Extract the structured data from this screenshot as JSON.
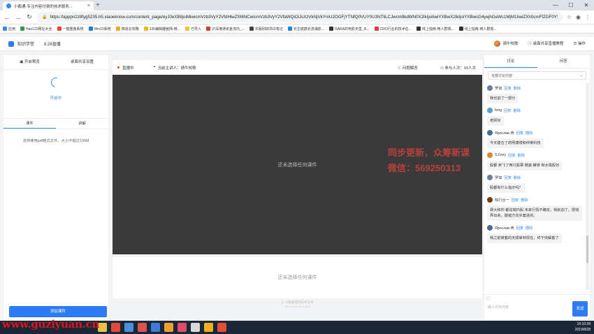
{
  "browser": {
    "tab_title": "小鹅通-专注内容付费的技术服务...",
    "new_tab": "+",
    "window_controls": [
      "—",
      "☐",
      "✕"
    ],
    "url": "https://apppn2z8fyg5235.h5.xiaoeknow.com/content_page/eyJ0eXBlIjoiMiwicmVzb3VyY2VfdHlwZSI6NCwicmVzb3VyY2VfaWQiOiJsXzVkNjVkYmU2OGFjYTNfQ0VUY0U3NTliLCJwcm9kdWN0X2lkIjoiIiwiYXBwX2lkIjoiYXBwcG4yejhGeWc1MjM1IiwiZXh0cmFfZGF0YSI6MH0",
    "bookmarks": [
      {
        "label": "应用",
        "color": "#4285f4"
      },
      {
        "label": "Hao123网址大全",
        "color": "#2e9a4a"
      },
      {
        "label": "一键重装系统",
        "color": "#e8432d"
      },
      {
        "label": "Win10系统",
        "color": "#1f7ae0"
      },
      {
        "label": "简道云攻略",
        "color": "#f1a722"
      },
      {
        "label": "135编辑器官网-微...",
        "color": "#f3b51b"
      },
      {
        "label": "已导入",
        "color": "#f1c232"
      },
      {
        "label": "沪深港通资金流向_...",
        "color": "#d93a2f"
      },
      {
        "label": "衣服别掉漂白笔记",
        "color": "#444444"
      },
      {
        "label": "长生底筋长流涌影...",
        "color": "#1e88e5"
      },
      {
        "label": "RARA的电影天堂_R...",
        "color": "#333333"
      },
      {
        "label": "CRO行业的技术任...",
        "color": "#e53935"
      },
      {
        "label": "线上指南-用人群观...",
        "color": "#333333"
      },
      {
        "label": "线上指南-用人群观...",
        "color": "#333333"
      }
    ]
  },
  "header": {
    "brand": "知识学堂",
    "course": "8.28直播",
    "user": "骑牛校歌",
    "share_tutorial": "桌面共享直播教程",
    "menu": "操作"
  },
  "left": {
    "tabs": [
      "开启预览",
      "桌面共享设置"
    ],
    "status": "开启中",
    "subtabs": [
      "课件",
      "讲解"
    ],
    "hint": "支持使用pdf格式文件，大小不超过100M",
    "add_button": "添加课件"
  },
  "center": {
    "live_label": "直播中",
    "presenter_label": "当前主讲人：骑牛校歌",
    "qa_label": "问题解答",
    "participants": "参与人次：93人次",
    "empty_stage": "还未选择任何课件",
    "empty_lower": "还未选择任何课件",
    "footer_brand": "小鹅通提供技术支持",
    "footer_url": "www.xiaoe-tech.com"
  },
  "watermark": {
    "line1": "同步更新，众筹新课",
    "line2": "微信：569250313"
  },
  "right": {
    "tabs": [
      "讨论",
      "问答"
    ],
    "filter": "全部讨论内容",
    "messages": [
      {
        "name": "罗如",
        "reply": "回复",
        "del": "删除",
        "text": "我也割了一部分",
        "color": "#6b7f99"
      },
      {
        "name": "feng",
        "reply": "回复",
        "del": "删除",
        "text": "老师好",
        "color": "#5aa0d8"
      },
      {
        "name": "Ярослав-肯",
        "reply": "回复",
        "del": "删除",
        "text": "今天建仓了药明康德和仲荣科技",
        "color": "#4a6b8a"
      },
      {
        "name": "S.Grey",
        "reply": "回复",
        "del": "删除",
        "text": "股都 卖飞了两只股票 微姿·錐芽 和太极股份",
        "color": "#d88a30"
      },
      {
        "name": "罗如",
        "reply": "回复",
        "del": "删除",
        "text": "股都有什么指示吗？",
        "color": "#6b7f99"
      },
      {
        "name": "知行合一",
        "reply": "回复",
        "del": "删除",
        "text": "费大和你 都说端内股 未来行情不确定。我就割了。把钱弄出来。踏错方向买套进的。",
        "color": "#7a3b14"
      },
      {
        "name": "Ярослав-肯",
        "reply": "回复",
        "del": "删除",
        "text": "我之前被套的天顺拿到现在，终于快解套了",
        "color": "#4a6b8a"
      }
    ],
    "input_placeholder": "输入讨论内容",
    "send": "发送"
  },
  "taskbar": {
    "site": "www.guziyuan.cn",
    "time": "19:10:28",
    "date": "2019/8/28",
    "icons": [
      "#e8c24a",
      "#e04a3a",
      "#4a90d9",
      "#d9534f",
      "#3d7bd9",
      "#f0a030",
      "#e24a6a",
      "#d9d9d9",
      "#f0b020",
      "#e34e3a"
    ]
  }
}
